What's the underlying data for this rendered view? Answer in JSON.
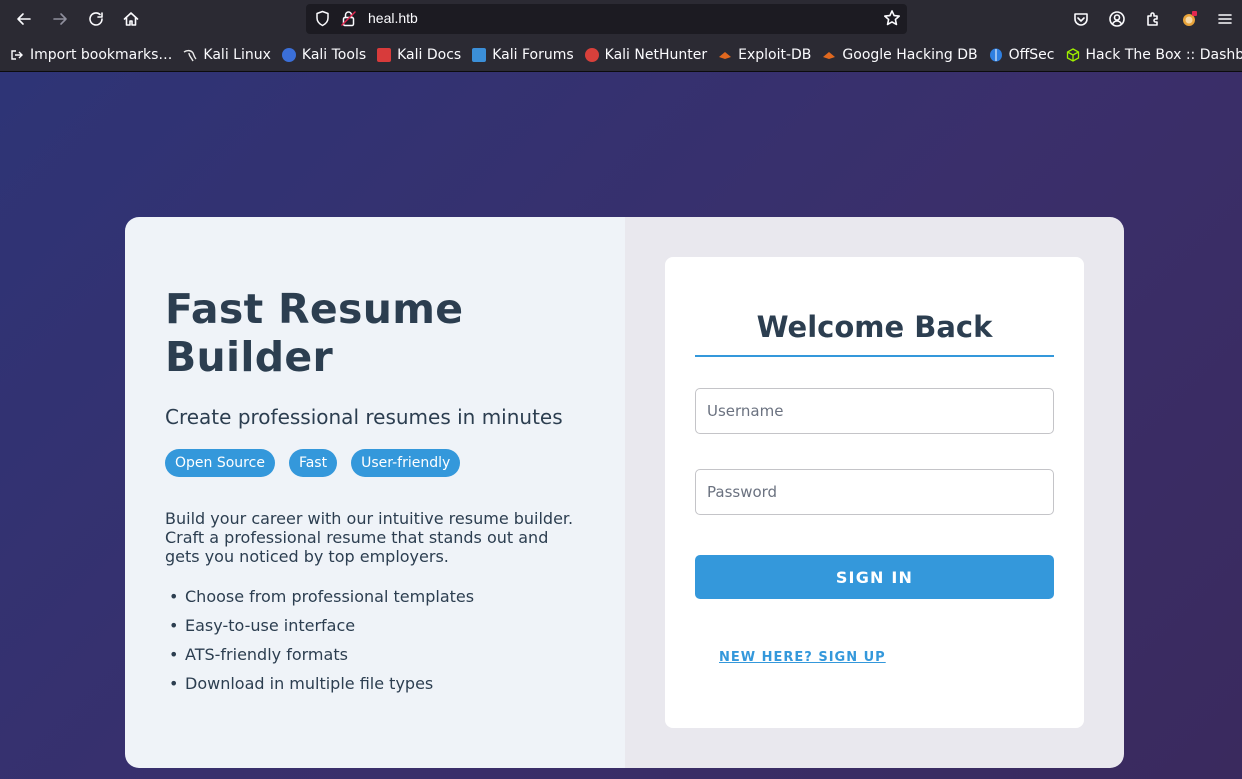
{
  "browser": {
    "url": "heal.htb",
    "bookmarks": [
      {
        "label": "Import bookmarks…",
        "icon": "import-icon",
        "color": "#fbfbfe"
      },
      {
        "label": "Kali Linux",
        "icon": "kali-dragon-icon",
        "color": "#e8e8e8"
      },
      {
        "label": "Kali Tools",
        "icon": "kali-tools-icon",
        "color": "#3b6fd8"
      },
      {
        "label": "Kali Docs",
        "icon": "kali-docs-icon",
        "color": "#d83b3b"
      },
      {
        "label": "Kali Forums",
        "icon": "kali-forums-icon",
        "color": "#3b8fd8"
      },
      {
        "label": "Kali NetHunter",
        "icon": "kali-nethunter-icon",
        "color": "#d8403b"
      },
      {
        "label": "Exploit-DB",
        "icon": "exploit-db-icon",
        "color": "#e0681f"
      },
      {
        "label": "Google Hacking DB",
        "icon": "ghdb-icon",
        "color": "#e0681f"
      },
      {
        "label": "OffSec",
        "icon": "offsec-icon",
        "color": "#2f7fe0"
      },
      {
        "label": "Hack The Box :: Dashb…",
        "icon": "htb-icon",
        "color": "#9fef00"
      }
    ]
  },
  "hero": {
    "title": "Fast Resume Builder",
    "subtitle": "Create professional resumes in minutes",
    "tags": [
      "Open Source",
      "Fast",
      "User-friendly"
    ],
    "description": "Build your career with our intuitive resume builder. Craft a professional resume that stands out and gets you noticed by top employers.",
    "features": [
      "Choose from professional templates",
      "Easy-to-use interface",
      "ATS-friendly formats",
      "Download in multiple file types"
    ]
  },
  "login": {
    "title": "Welcome Back",
    "username_placeholder": "Username",
    "password_placeholder": "Password",
    "signin_label": "SIGN IN",
    "signup_link": "NEW HERE? SIGN UP"
  },
  "colors": {
    "accent": "#3498db",
    "heading": "#2c3e50"
  }
}
